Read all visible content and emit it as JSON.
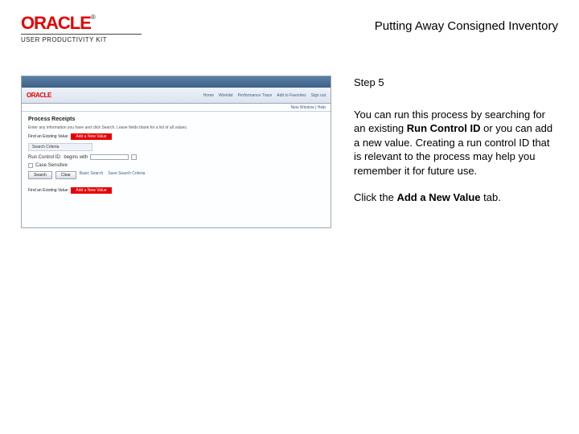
{
  "logo": {
    "brand": "ORACLE",
    "tm": "®",
    "sublabel": "USER PRODUCTIVITY KIT"
  },
  "page_title": "Putting Away Consigned Inventory",
  "instruction": {
    "step_label": "Step 5",
    "para1_pre": "You can run this process by searching for an existing ",
    "para1_bold": "Run Control ID",
    "para1_post": " or you can add a new value. Creating a run control ID that is relevant to the process may help you remember it for future use.",
    "para2_pre": "Click the ",
    "para2_bold": "Add a New Value",
    "para2_post": " tab."
  },
  "ss": {
    "brand": "ORACLE",
    "nav": [
      "Home",
      "Worklist",
      "Performance Trace",
      "Add to Favorites",
      "Sign out"
    ],
    "subbar": "New Window | Help",
    "page_heading": "Process Receipts",
    "desc": "Enter any information you have and click Search. Leave fields blank for a list of all values.",
    "tab_find": "Find an Existing Value",
    "tab_add": "Add a New Value",
    "section": "Search Criteria",
    "field_label": "Run Control ID:",
    "field_op": "begins with",
    "case_label": "Case Sensitive",
    "btn_search": "Search",
    "btn_clear": "Clear",
    "link_basic": "Basic Search",
    "link_save": "Save Search Criteria",
    "footer_label": "Find an Existing Value",
    "footer_hl": "Add a New Value"
  }
}
